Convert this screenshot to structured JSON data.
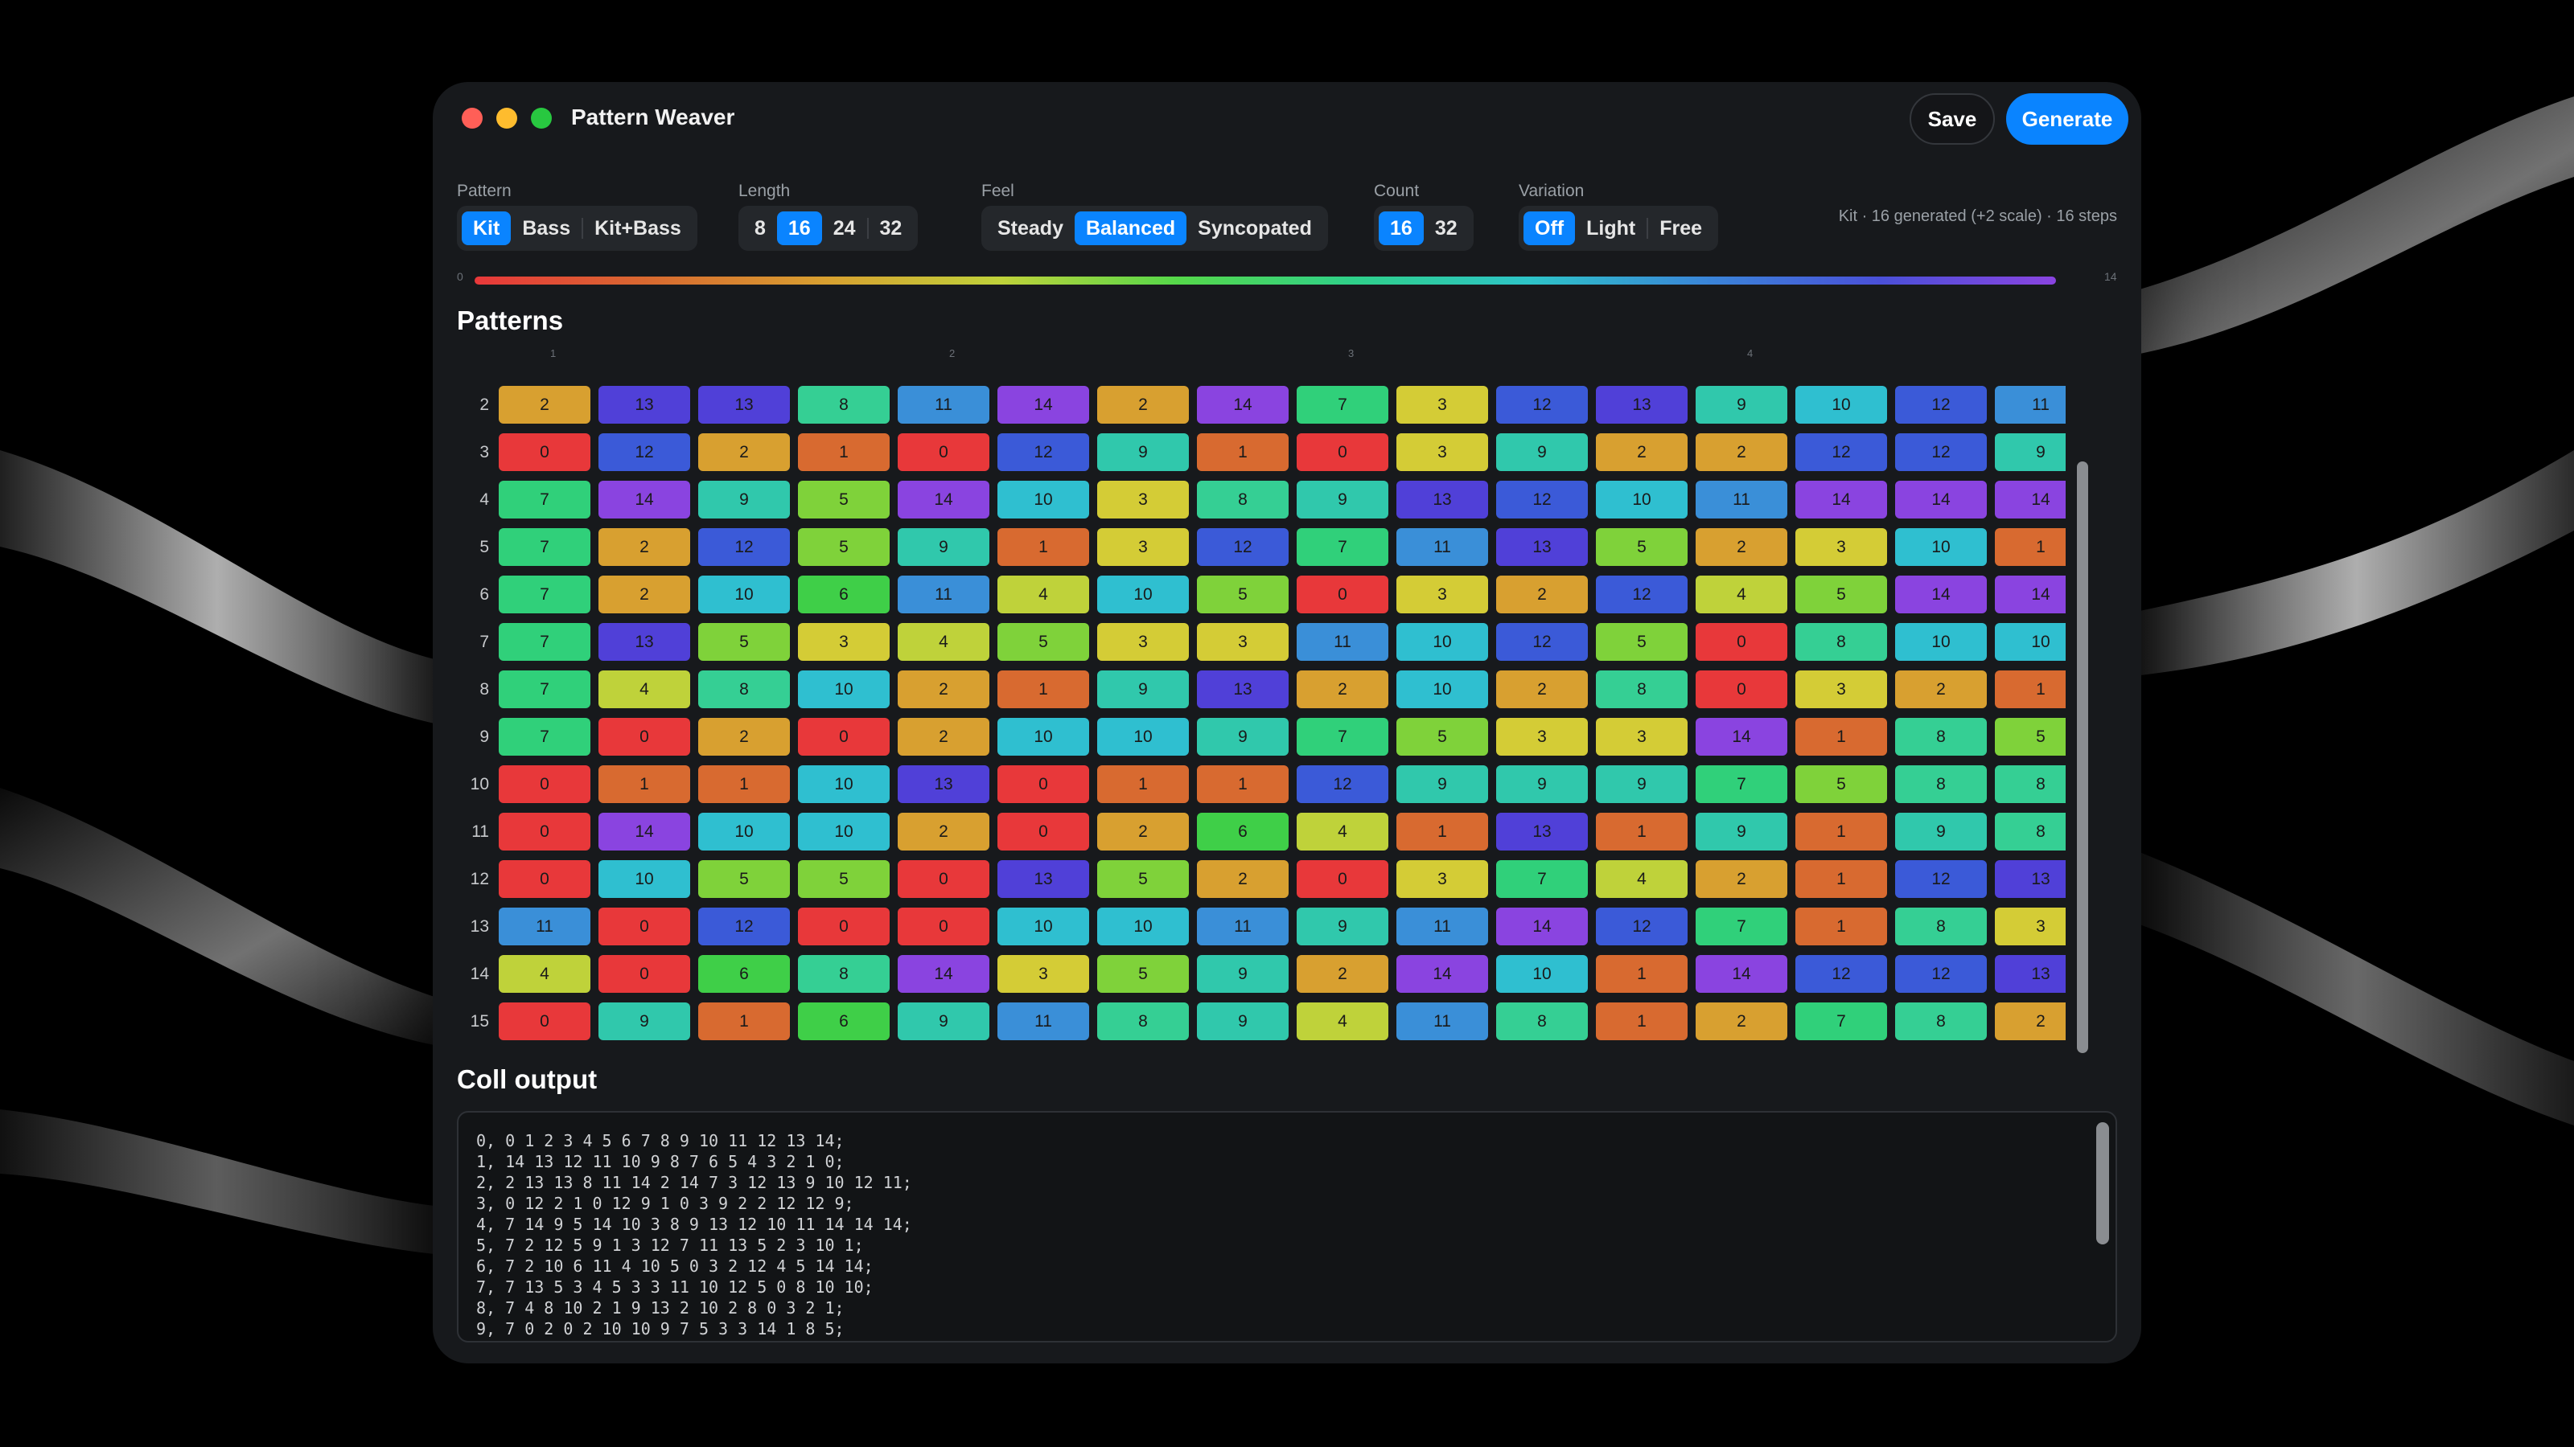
{
  "window": {
    "title": "Pattern Weaver"
  },
  "toolbar": {
    "save_label": "Save",
    "generate_label": "Generate"
  },
  "controls": {
    "pattern": {
      "label": "Pattern",
      "options": [
        "Kit",
        "Bass",
        "Kit+Bass"
      ],
      "selected": "Kit"
    },
    "length": {
      "label": "Length",
      "options": [
        "8",
        "16",
        "24",
        "32"
      ],
      "selected": "16"
    },
    "feel": {
      "label": "Feel",
      "options": [
        "Steady",
        "Balanced",
        "Syncopated"
      ],
      "selected": "Balanced"
    },
    "count": {
      "label": "Count",
      "options": [
        "16",
        "32"
      ],
      "selected": "16"
    },
    "variation": {
      "label": "Variation",
      "options": [
        "Off",
        "Light",
        "Free"
      ],
      "selected": "Off"
    },
    "summary": "Kit · 16 generated (+2 scale) · 16 steps"
  },
  "ramp": {
    "min_label": "0",
    "max_label": "14"
  },
  "patterns": {
    "title": "Patterns",
    "beat_labels": [
      "1",
      "2",
      "3",
      "4"
    ],
    "rows": [
      {
        "label": "2",
        "cells": [
          2,
          13,
          13,
          8,
          11,
          14,
          2,
          14,
          7,
          3,
          12,
          13,
          9,
          10,
          12,
          11
        ]
      },
      {
        "label": "3",
        "cells": [
          0,
          12,
          2,
          1,
          0,
          12,
          9,
          1,
          0,
          3,
          9,
          2,
          2,
          12,
          12,
          9
        ]
      },
      {
        "label": "4",
        "cells": [
          7,
          14,
          9,
          5,
          14,
          10,
          3,
          8,
          9,
          13,
          12,
          10,
          11,
          14,
          14,
          14
        ]
      },
      {
        "label": "5",
        "cells": [
          7,
          2,
          12,
          5,
          9,
          1,
          3,
          12,
          7,
          11,
          13,
          5,
          2,
          3,
          10,
          1
        ]
      },
      {
        "label": "6",
        "cells": [
          7,
          2,
          10,
          6,
          11,
          4,
          10,
          5,
          0,
          3,
          2,
          12,
          4,
          5,
          14,
          14
        ]
      },
      {
        "label": "7",
        "cells": [
          7,
          13,
          5,
          3,
          4,
          5,
          3,
          3,
          11,
          10,
          12,
          5,
          0,
          8,
          10,
          10
        ]
      },
      {
        "label": "8",
        "cells": [
          7,
          4,
          8,
          10,
          2,
          1,
          9,
          13,
          2,
          10,
          2,
          8,
          0,
          3,
          2,
          1
        ]
      },
      {
        "label": "9",
        "cells": [
          7,
          0,
          2,
          0,
          2,
          10,
          10,
          9,
          7,
          5,
          3,
          3,
          14,
          1,
          8,
          5
        ]
      },
      {
        "label": "10",
        "cells": [
          0,
          1,
          1,
          10,
          13,
          0,
          1,
          1,
          12,
          9,
          9,
          9,
          7,
          5,
          8,
          8
        ]
      },
      {
        "label": "11",
        "cells": [
          0,
          14,
          10,
          10,
          2,
          0,
          2,
          6,
          4,
          1,
          13,
          1,
          9,
          1,
          9,
          8
        ]
      },
      {
        "label": "12",
        "cells": [
          0,
          10,
          5,
          5,
          0,
          13,
          5,
          2,
          0,
          3,
          7,
          4,
          2,
          1,
          12,
          13
        ]
      },
      {
        "label": "13",
        "cells": [
          11,
          0,
          12,
          0,
          0,
          10,
          10,
          11,
          9,
          11,
          14,
          12,
          7,
          1,
          8,
          3
        ]
      },
      {
        "label": "14",
        "cells": [
          4,
          0,
          6,
          8,
          14,
          3,
          5,
          9,
          2,
          14,
          10,
          1,
          14,
          12,
          12,
          13
        ]
      },
      {
        "label": "15",
        "cells": [
          0,
          9,
          1,
          6,
          9,
          11,
          8,
          9,
          4,
          11,
          8,
          1,
          2,
          7,
          8,
          2
        ]
      }
    ],
    "palette": [
      "#e8383a",
      "#d86a30",
      "#d8a030",
      "#d4cc36",
      "#bfd23a",
      "#7fd23a",
      "#3fcf48",
      "#30d07a",
      "#35cf94",
      "#30c8ac",
      "#2fbfd0",
      "#3a8fd8",
      "#3b5ad8",
      "#5040d8",
      "#8a44e0"
    ]
  },
  "coll": {
    "title": "Coll output",
    "lines": [
      "0, 0 1 2 3 4 5 6 7 8 9 10 11 12 13 14;",
      "1, 14 13 12 11 10 9 8 7 6 5 4 3 2 1 0;",
      "2, 2 13 13 8 11 14 2 14 7 3 12 13 9 10 12 11;",
      "3, 0 12 2 1 0 12 9 1 0 3 9 2 2 12 12 9;",
      "4, 7 14 9 5 14 10 3 8 9 13 12 10 11 14 14 14;",
      "5, 7 2 12 5 9 1 3 12 7 11 13 5 2 3 10 1;",
      "6, 7 2 10 6 11 4 10 5 0 3 2 12 4 5 14 14;",
      "7, 7 13 5 3 4 5 3 3 11 10 12 5 0 8 10 10;",
      "8, 7 4 8 10 2 1 9 13 2 10 2 8 0 3 2 1;",
      "9, 7 0 2 0 2 10 10 9 7 5 3 3 14 1 8 5;"
    ]
  }
}
